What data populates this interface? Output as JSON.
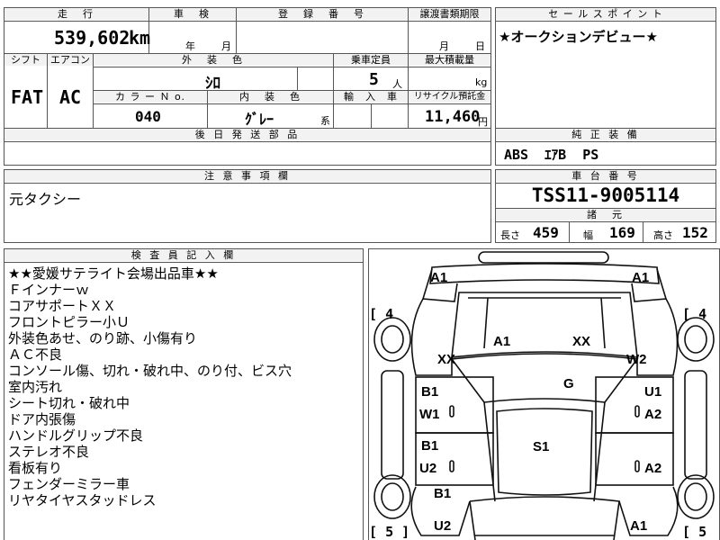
{
  "headers": {
    "mileage": "走　行",
    "inspection": "車　検",
    "registration": "登　録　番　号",
    "transfer_deadline": "譲渡書類期限",
    "sales_point": "セ ー ル ス ポ イ ン ト",
    "shift": "シフト",
    "aircon": "エアコン",
    "exterior_color": "外　装　色",
    "capacity": "乗車定員",
    "max_load": "最大積載量",
    "color_no": "カ ラ ー Ｎ o.",
    "interior_color": "内　装　色",
    "import": "輸　入　車",
    "recycle_fee": "リサイクル預託金",
    "deferred_parts": "後 日 発 送 部 品",
    "factory_equipment": "純 正 装 備",
    "notes": "注 意 事 項 欄",
    "chassis_no": "車 台 番 号",
    "specs": "諸　元",
    "inspector": "検 査 員 記 入 欄"
  },
  "vehicle": {
    "mileage": "539,602",
    "mileage_unit": "km",
    "inspection_year_unit": "年",
    "inspection_month_unit": "月",
    "transfer_month_unit": "月",
    "transfer_day_unit": "日",
    "shift": "FAT",
    "aircon": "AC",
    "exterior_color": "ｼﾛ",
    "capacity": "5",
    "capacity_unit": "人",
    "load_unit": "kg",
    "color_no": "040",
    "interior_color": "ｸﾞﾚｰ",
    "interior_suffix": "系",
    "recycle_fee": "11,460",
    "recycle_unit": "円",
    "equipment": "ABS  ｴｱB  PS",
    "chassis_no": "TSS11-9005114"
  },
  "sales_point": "★オークションデビュー★",
  "notes": "元タクシー",
  "specs": {
    "length_label": "長さ",
    "length": "459",
    "width_label": "幅",
    "width": "169",
    "height_label": "高さ",
    "height": "152"
  },
  "inspector_remarks": [
    "★★愛媛サテライト会場出品車★★",
    "Ｆインナーｗ",
    "コアサポートＸＸ",
    "フロントピラー小Ｕ",
    "外装色あせ、のり跡、小傷有り",
    "ＡＣ不良",
    "コンソール傷、切れ・破れ中、のり付、ビス穴",
    "室内汚れ",
    "シート切れ・破れ中",
    "ドア内張傷",
    "ハンドルグリップ不良",
    "ステレオ不良",
    "看板有り",
    "フェンダーミラー車",
    "リヤタイヤスタッドレス"
  ],
  "diagram": {
    "tire_front_left": "4",
    "tire_front_right": "4",
    "tire_rear_left": "5",
    "tire_rear_right": "5",
    "bracket_open": "[",
    "bracket_close": "]",
    "labels": {
      "front_left_corner": "A1",
      "front_right_corner": "A1",
      "hood": "A1",
      "hood_right": "XX",
      "left_front_fender": "XX",
      "right_front_fender": "W2",
      "windshield": "G",
      "left_front_door_top": "B1",
      "left_front_door_bottom": "W1",
      "right_front_door_top": "U1",
      "right_front_door_bottom": "A2",
      "left_rear_door_top": "B1",
      "left_rear_door_bottom": "U2",
      "right_rear_door": "A2",
      "roof": "S1",
      "left_rear_fender": "B1",
      "left_rear_corner": "U2",
      "right_rear_corner": "A1"
    }
  }
}
